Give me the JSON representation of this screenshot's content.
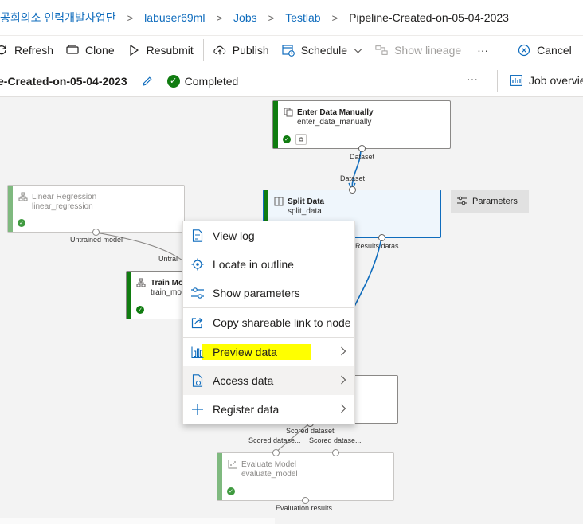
{
  "breadcrumb": {
    "items": [
      "공회의소 인력개발사업단",
      "labuser69ml",
      "Jobs",
      "Testlab",
      "Pipeline-Created-on-05-04-2023"
    ],
    "separator": ">"
  },
  "toolbar": {
    "refresh": "Refresh",
    "clone": "Clone",
    "resubmit": "Resubmit",
    "publish": "Publish",
    "schedule": "Schedule",
    "show_lineage": "Show lineage",
    "more": "···",
    "cancel": "Cancel"
  },
  "titlebar": {
    "run_name": "e-Created-on-05-04-2023",
    "status": "Completed",
    "more": "···",
    "job_overview": "Job overview"
  },
  "nodes": {
    "enter_data": {
      "title": "Enter Data Manually",
      "sub": "enter_data_manually"
    },
    "linear_regression": {
      "title": "Linear Regression",
      "sub": "linear_regression"
    },
    "split_data": {
      "title": "Split Data",
      "sub": "split_data"
    },
    "train_model": {
      "title": "Train Mod",
      "sub": "train_mod"
    },
    "evaluate_model": {
      "title": "Evaluate Model",
      "sub": "evaluate_model"
    }
  },
  "ports": {
    "dataset_out": "Dataset",
    "dataset_in": "Dataset",
    "untrained_model": "Untrained model",
    "untrai": "Untrai",
    "results_datas": "Results datas...",
    "scored_dataset": "Scored dataset",
    "scored_datase_1": "Scored datase...",
    "scored_datase_2": "Scored datase...",
    "evaluation_results": "Evaluation results"
  },
  "parameters_button": "Parameters",
  "context_menu": {
    "items": [
      "View log",
      "Locate in outline",
      "Show parameters",
      "Copy shareable link to node",
      "Preview data",
      "Access data",
      "Register data"
    ]
  },
  "colors": {
    "accent": "#0f6cbd",
    "success": "#107c10",
    "highlight": "#ffff00"
  }
}
